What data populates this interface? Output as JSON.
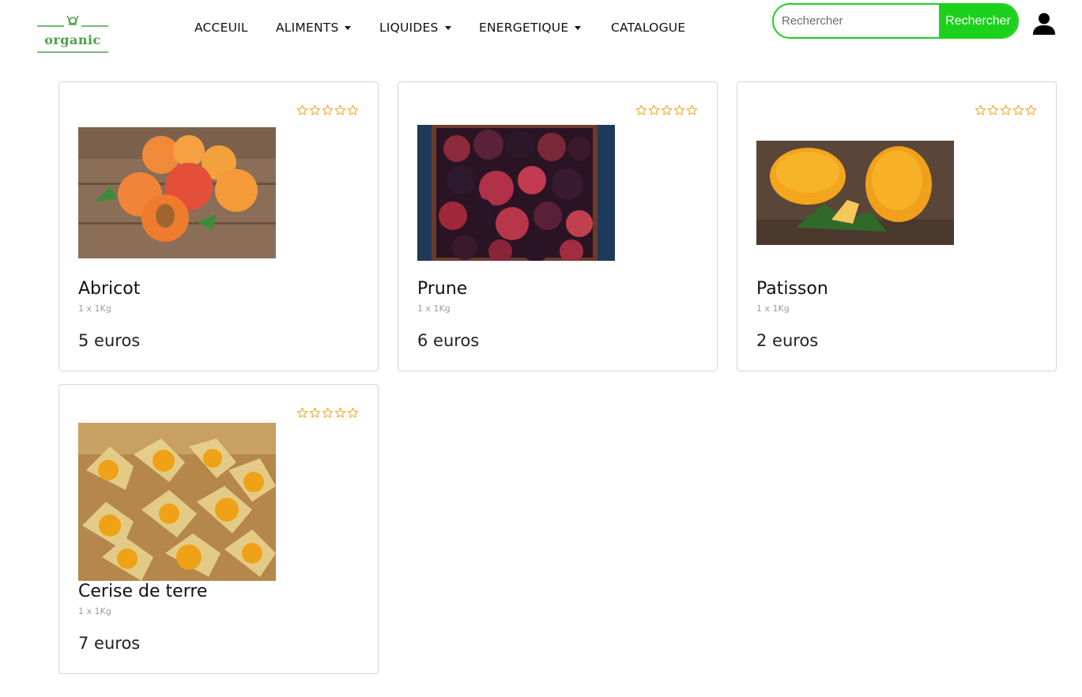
{
  "header": {
    "logo_text": "organic",
    "nav": [
      {
        "label": "ACCEUIL",
        "has_dropdown": false
      },
      {
        "label": "ALIMENTS",
        "has_dropdown": true
      },
      {
        "label": "LIQUIDES",
        "has_dropdown": true
      },
      {
        "label": "ENERGETIQUE",
        "has_dropdown": true
      },
      {
        "label": "CATALOGUE",
        "has_dropdown": false
      }
    ],
    "search": {
      "placeholder": "Rechercher",
      "value": "",
      "button_label": "Rechercher"
    },
    "user_icon": "user-icon"
  },
  "colors": {
    "accent": "#1bd11b",
    "logo": "#4aa24a",
    "star": "#f0a51e"
  },
  "products": [
    {
      "name": "Abricot",
      "quantity": "1 x 1Kg",
      "price": "5 euros",
      "rating": 0,
      "rating_max": 5,
      "image": "apricots-photo"
    },
    {
      "name": "Prune",
      "quantity": "1 x 1Kg",
      "price": "6 euros",
      "rating": 0,
      "rating_max": 5,
      "image": "plums-photo"
    },
    {
      "name": "Patisson",
      "quantity": "1 x 1Kg",
      "price": "2 euros",
      "rating": 0,
      "rating_max": 5,
      "image": "pattypan-squash-photo"
    },
    {
      "name": "Cerise de terre",
      "quantity": "1 x 1Kg",
      "price": "7 euros",
      "rating": 0,
      "rating_max": 5,
      "image": "physalis-photo"
    }
  ]
}
